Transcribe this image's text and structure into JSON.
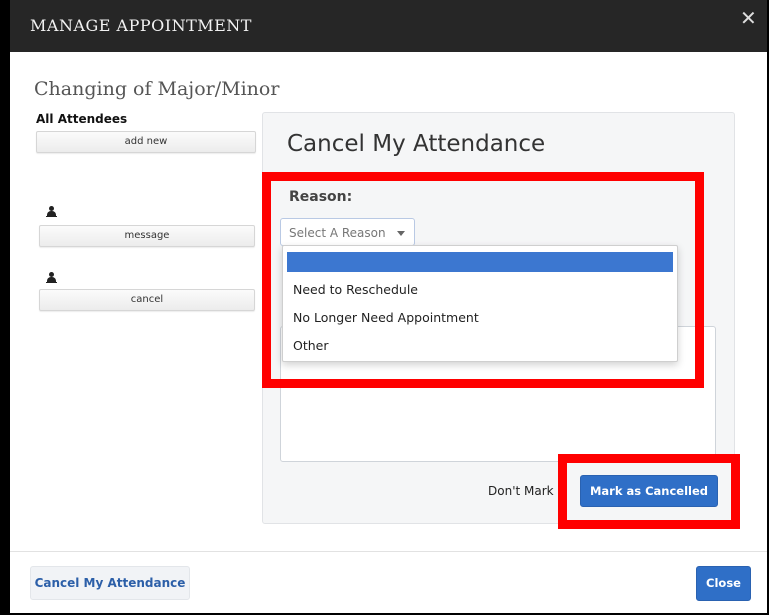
{
  "modal": {
    "title": "MANAGE APPOINTMENT",
    "close_icon": "close-icon",
    "close_glyph": "✕"
  },
  "page": {
    "title": "Changing of Major/Minor"
  },
  "attendees": {
    "label": "All Attendees",
    "add_new_label": "add new",
    "message_label": "message",
    "cancel_label": "cancel",
    "person_icon": "person-icon"
  },
  "cancel_panel": {
    "title": "Cancel My Attendance",
    "reason_label": "Reason:",
    "select_placeholder": "Select A Reason",
    "options": [
      "",
      "Need to Reschedule",
      "No Longer Need Appointment",
      "Other"
    ],
    "dont_mark_label": "Don't Mark",
    "mark_cancelled_label": "Mark as Cancelled"
  },
  "footer": {
    "cancel_attendance_label": "Cancel My Attendance",
    "close_label": "Close"
  },
  "colors": {
    "header_bg": "#262626",
    "primary": "#2f6fc7",
    "highlight": "#ff0000",
    "selected_option": "#3c77d0"
  }
}
